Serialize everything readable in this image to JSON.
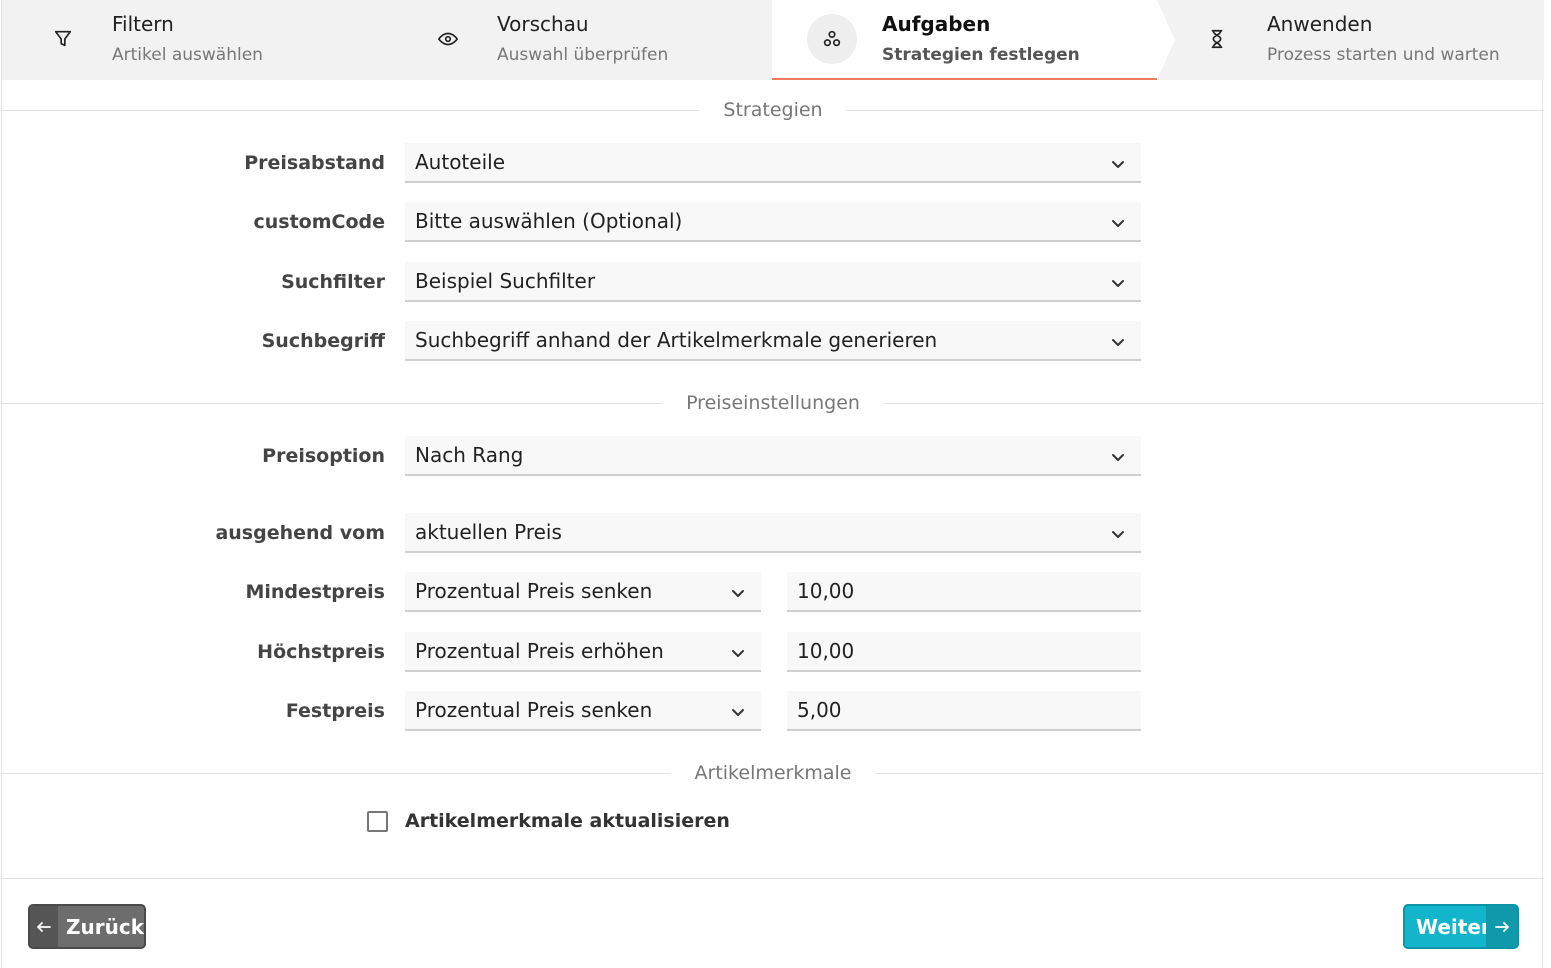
{
  "stepper": {
    "steps": [
      {
        "title": "Filtern",
        "subtitle": "Artikel auswählen",
        "icon": "filter-icon"
      },
      {
        "title": "Vorschau",
        "subtitle": "Auswahl überprüfen",
        "icon": "eye-icon"
      },
      {
        "title": "Aufgaben",
        "subtitle": "Strategien festlegen",
        "icon": "tasks-icon",
        "active": true
      },
      {
        "title": "Anwenden",
        "subtitle": "Prozess starten und warten",
        "icon": "hourglass-icon"
      }
    ],
    "active_accent": "#f07b5e"
  },
  "sections": {
    "strategien": "Strategien",
    "preiseinstellungen": "Preiseinstellungen",
    "artikelmerkmale": "Artikelmerkmale"
  },
  "strategien": {
    "preisabstand": {
      "label": "Preisabstand",
      "value": "Autoteile"
    },
    "customcode": {
      "label": "customCode",
      "value": "Bitte auswählen (Optional)"
    },
    "suchfilter": {
      "label": "Suchfilter",
      "value": "Beispiel Suchfilter"
    },
    "suchbegriff": {
      "label": "Suchbegriff",
      "value": "Suchbegriff anhand der Artikelmerkmale generieren"
    }
  },
  "preiseinstellungen": {
    "preisoption": {
      "label": "Preisoption",
      "value": "Nach Rang"
    },
    "ausgehend": {
      "label": "ausgehend vom",
      "value": "aktuellen Preis"
    },
    "mindestpreis": {
      "label": "Mindestpreis",
      "mode": "Prozentual Preis senken",
      "amount": "10,00"
    },
    "hoechstpreis": {
      "label": "Höchstpreis",
      "mode": "Prozentual Preis erhöhen",
      "amount": "10,00"
    },
    "festpreis": {
      "label": "Festpreis",
      "mode": "Prozentual Preis senken",
      "amount": "5,00"
    }
  },
  "artikelmerkmale": {
    "checkbox_label": "Artikelmerkmale aktualisieren",
    "checked": false
  },
  "footer": {
    "back_label": "Zurück",
    "next_label": "Weiter",
    "next_color": "#12b5c9",
    "back_color": "#6d6d6d"
  }
}
